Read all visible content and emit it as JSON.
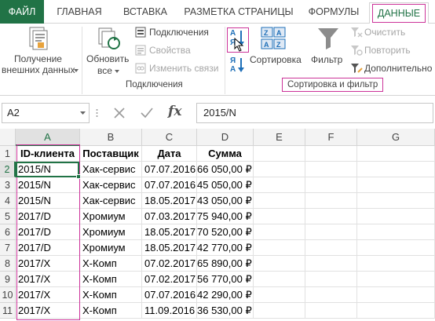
{
  "tabs": [
    "ФАЙЛ",
    "ГЛАВНАЯ",
    "ВСТАВКА",
    "РАЗМЕТКА СТРАНИЦЫ",
    "ФОРМУЛЫ",
    "ДАННЫЕ"
  ],
  "ribbon": {
    "get_external": [
      "Получение",
      "внешних данных"
    ],
    "refresh_all": [
      "Обновить",
      "все"
    ],
    "connections": "Подключения",
    "properties": "Свойства",
    "edit_links": "Изменить связи",
    "connections_group": "Подключения",
    "sort": "Сортировка",
    "filter": "Фильтр",
    "clear": "Очистить",
    "reapply": "Повторить",
    "advanced": "Дополнительно",
    "sort_filter_group": "Сортировка и фильтр",
    "sort_az_top": "А",
    "sort_az_bottom": "Я",
    "sort_za_top": "Я",
    "sort_za_bottom": "А"
  },
  "formula_bar": {
    "name_box": "A2",
    "fx": "fx",
    "formula": "2015/N"
  },
  "colors": {
    "accent": "#217346",
    "highlight": "#cc3399"
  },
  "columns": [
    "A",
    "B",
    "C",
    "D",
    "E",
    "F",
    "G"
  ],
  "rows": [
    "1",
    "2",
    "3",
    "4",
    "5",
    "6",
    "7",
    "8",
    "9",
    "10",
    "11"
  ],
  "header_row": [
    "ID-клиента",
    "Поставщик",
    "Дата",
    "Сумма"
  ],
  "data_rows": [
    [
      "2015/N",
      "Хак-сервис",
      "07.07.2016",
      "66 050,00 ₽"
    ],
    [
      "2015/N",
      "Хак-сервис",
      "07.07.2016",
      "45 050,00 ₽"
    ],
    [
      "2015/N",
      "Хак-сервис",
      "18.05.2017",
      "43 050,00 ₽"
    ],
    [
      "2017/D",
      "Хромиум",
      "07.03.2017",
      "75 940,00 ₽"
    ],
    [
      "2017/D",
      "Хромиум",
      "18.05.2017",
      "70 520,00 ₽"
    ],
    [
      "2017/D",
      "Хромиум",
      "18.05.2017",
      "42 770,00 ₽"
    ],
    [
      "2017/X",
      "Х-Комп",
      "07.02.2017",
      "65 890,00 ₽"
    ],
    [
      "2017/X",
      "Х-Комп",
      "07.02.2017",
      "56 770,00 ₽"
    ],
    [
      "2017/X",
      "Х-Комп",
      "07.07.2016",
      "42 290,00 ₽"
    ],
    [
      "2017/X",
      "Х-Комп",
      "11.09.2016",
      "36 530,00 ₽"
    ]
  ]
}
